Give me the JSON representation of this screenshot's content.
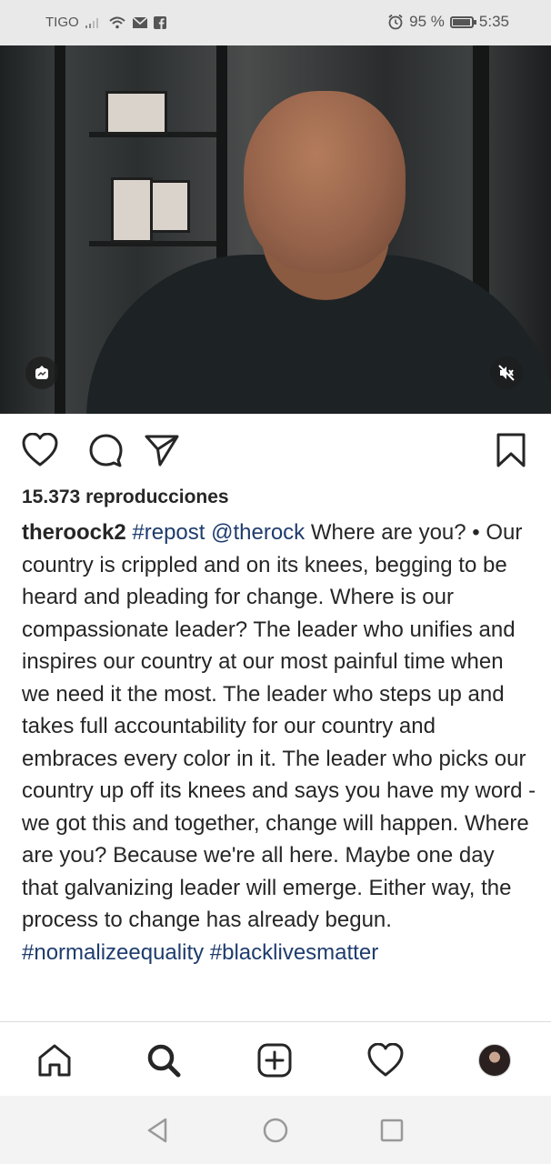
{
  "status_bar": {
    "carrier": "TIGO",
    "battery_text": "95 %",
    "battery_level": 0.95,
    "time": "5:35"
  },
  "post": {
    "views": "15.373 reproducciones",
    "username": "theroock2",
    "caption_segments": [
      {
        "text": "#repost",
        "type": "hashtag"
      },
      {
        "text": "@therock",
        "type": "mention"
      },
      {
        "text": "Where are you? • Our country is crippled and on its knees, begging to be heard and pleading for change. Where is our compassionate leader? The leader who unifies and inspires our country at our most painful time when we need it the most. The leader who steps up and takes full accountability for our country and embraces every color in it. The leader who picks our country up off its knees and says you have my word - we got this and together, change will happen. Where are you? Because we're all here. Maybe one day that galvanizing leader will emerge. Either way, the process to change has already begun.",
        "type": "text"
      },
      {
        "text": "#normalizeequality",
        "type": "hashtag"
      },
      {
        "text": "#blacklivesmatter",
        "type": "hashtag"
      }
    ]
  },
  "icons": {
    "like": "heart-icon",
    "comment": "comment-icon",
    "share": "send-icon",
    "save": "bookmark-icon",
    "mute": "speaker-muted-icon",
    "tag": "tag-people-icon",
    "home": "home-icon",
    "search": "search-icon",
    "new_post": "add-post-icon",
    "activity": "heart-icon",
    "profile": "avatar"
  },
  "colors": {
    "link": "#1e3c6e",
    "text": "#262626"
  }
}
